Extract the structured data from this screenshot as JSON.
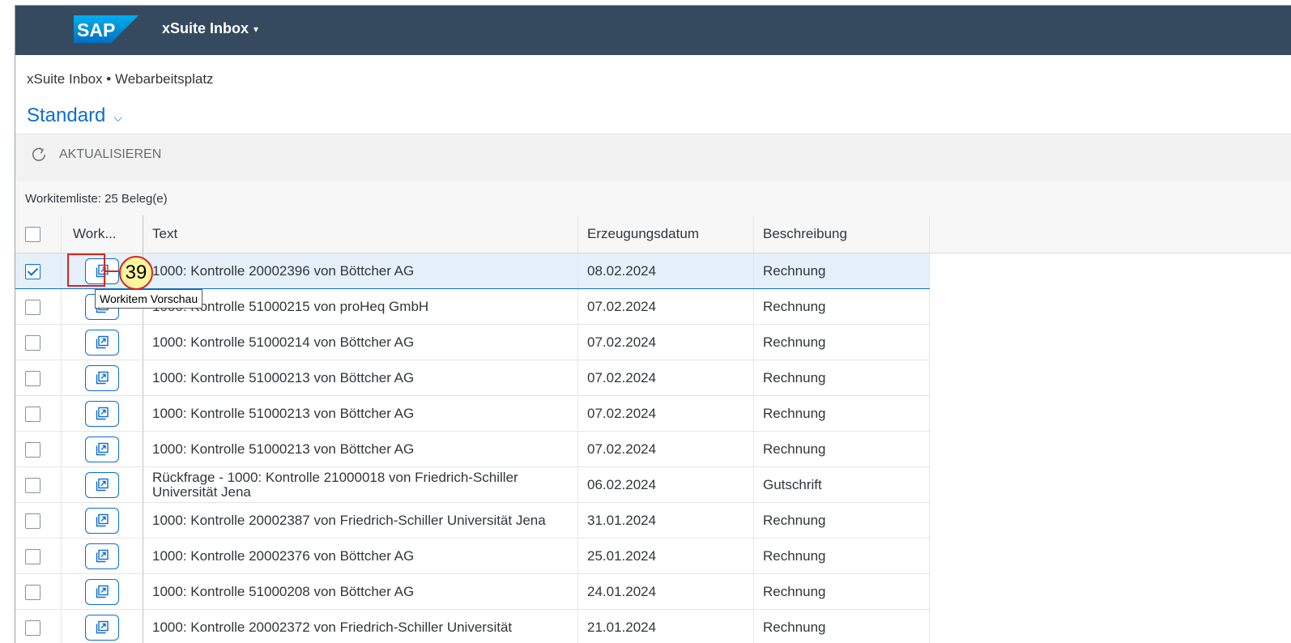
{
  "shell": {
    "logo_text": "SAP",
    "app_title": "xSuite Inbox",
    "app_title_caret": "▾"
  },
  "breadcrumb": "xSuite Inbox • Webarbeitsplatz",
  "variant": {
    "label": "Standard",
    "chevron": "⌵"
  },
  "toolbar": {
    "refresh_label": "AKTUALISIEREN",
    "refresh_icon": "refresh-icon"
  },
  "list": {
    "info": "Workitemliste: 25 Beleg(e)",
    "columns": {
      "workitem": "Work...",
      "text": "Text",
      "date": "Erzeugungsdatum",
      "desc": "Beschreibung"
    },
    "rows": [
      {
        "checked": true,
        "text": "1000: Kontrolle 20002396 von Böttcher AG",
        "date": "08.02.2024",
        "desc": "Rechnung"
      },
      {
        "checked": false,
        "text": "1000: Kontrolle 51000215 von proHeq GmbH",
        "date": "07.02.2024",
        "desc": "Rechnung"
      },
      {
        "checked": false,
        "text": "1000: Kontrolle 51000214 von Böttcher AG",
        "date": "07.02.2024",
        "desc": "Rechnung"
      },
      {
        "checked": false,
        "text": "1000: Kontrolle 51000213 von Böttcher AG",
        "date": "07.02.2024",
        "desc": "Rechnung"
      },
      {
        "checked": false,
        "text": "1000: Kontrolle 51000213 von Böttcher AG",
        "date": "07.02.2024",
        "desc": "Rechnung"
      },
      {
        "checked": false,
        "text": "1000: Kontrolle 51000213 von Böttcher AG",
        "date": "07.02.2024",
        "desc": "Rechnung"
      },
      {
        "checked": false,
        "text": "Rückfrage - 1000: Kontrolle 21000018 von Friedrich-Schiller Universität Jena",
        "date": "06.02.2024",
        "desc": "Gutschrift"
      },
      {
        "checked": false,
        "text": "1000: Kontrolle 20002387 von Friedrich-Schiller Universität Jena",
        "date": "31.01.2024",
        "desc": "Rechnung"
      },
      {
        "checked": false,
        "text": "1000: Kontrolle 20002376 von Böttcher AG",
        "date": "25.01.2024",
        "desc": "Rechnung"
      },
      {
        "checked": false,
        "text": "1000: Kontrolle 51000208 von Böttcher AG",
        "date": "24.01.2024",
        "desc": "Rechnung"
      },
      {
        "checked": false,
        "text": "1000: Kontrolle 20002372 von Friedrich-Schiller Universität",
        "date": "21.01.2024",
        "desc": "Rechnung"
      }
    ]
  },
  "annotation": {
    "step_number": "39",
    "tooltip": "Workitem Vorschau"
  },
  "colors": {
    "shell_bg": "#354a5f",
    "accent": "#0a6ed1",
    "selected_row": "#e5f0fa",
    "callout_red": "#e02020",
    "callout_badge": "#fff59d"
  }
}
